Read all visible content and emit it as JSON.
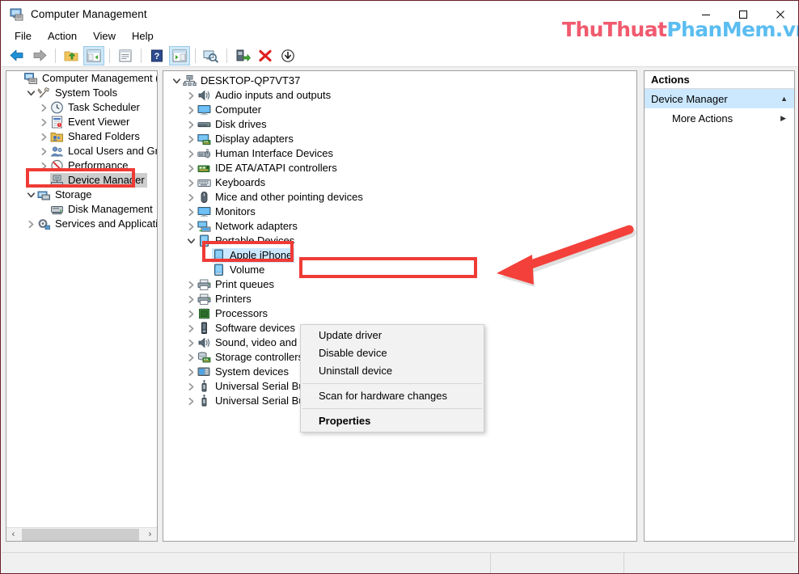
{
  "window": {
    "title": "Computer Management",
    "icon": "computer-management-icon",
    "minimize_label": "─",
    "maximize_label": "□",
    "close_label": "✕"
  },
  "watermark": {
    "part1": "ThuThuat",
    "part2": "PhanMem.vn",
    "color1": "#f05a6e",
    "color2": "#5bbdf0"
  },
  "menubar": {
    "items": [
      "File",
      "Action",
      "View",
      "Help"
    ]
  },
  "toolbar": {
    "buttons": [
      {
        "name": "back-icon",
        "tip": "Back"
      },
      {
        "name": "forward-icon",
        "tip": "Forward"
      },
      {
        "name": "up-folder-icon",
        "tip": "Up one level"
      },
      {
        "name": "show-hide-console-tree-icon",
        "tip": "Show/Hide Console Tree"
      },
      {
        "name": "properties-icon",
        "tip": "Properties"
      },
      {
        "name": "help-icon",
        "tip": "Help"
      },
      {
        "name": "show-hide-action-pane-icon",
        "tip": "Show/Hide Action Pane"
      },
      {
        "name": "scan-hardware-icon",
        "tip": "Scan for hardware changes"
      },
      {
        "name": "update-driver-icon",
        "tip": "Update driver"
      },
      {
        "name": "uninstall-device-icon",
        "tip": "Uninstall device"
      },
      {
        "name": "disable-device-icon",
        "tip": "Disable device"
      }
    ]
  },
  "console_tree": {
    "items": [
      {
        "label": "Computer Management (Local",
        "depth": 0,
        "chevron": "",
        "icon": "computer-management-icon",
        "selected": "none"
      },
      {
        "label": "System Tools",
        "depth": 1,
        "chevron": "expanded",
        "icon": "system-tools-icon",
        "selected": "none"
      },
      {
        "label": "Task Scheduler",
        "depth": 2,
        "chevron": "collapsed",
        "icon": "task-scheduler-icon",
        "selected": "none"
      },
      {
        "label": "Event Viewer",
        "depth": 2,
        "chevron": "collapsed",
        "icon": "event-viewer-icon",
        "selected": "none"
      },
      {
        "label": "Shared Folders",
        "depth": 2,
        "chevron": "collapsed",
        "icon": "shared-folders-icon",
        "selected": "none"
      },
      {
        "label": "Local Users and Groups",
        "depth": 2,
        "chevron": "collapsed",
        "icon": "local-users-icon",
        "selected": "none"
      },
      {
        "label": "Performance",
        "depth": 2,
        "chevron": "collapsed",
        "icon": "performance-icon",
        "selected": "none"
      },
      {
        "label": "Device Manager",
        "depth": 2,
        "chevron": "",
        "icon": "device-manager-icon",
        "selected": "gray"
      },
      {
        "label": "Storage",
        "depth": 1,
        "chevron": "expanded",
        "icon": "storage-icon",
        "selected": "none"
      },
      {
        "label": "Disk Management",
        "depth": 2,
        "chevron": "",
        "icon": "disk-management-icon",
        "selected": "none"
      },
      {
        "label": "Services and Applications",
        "depth": 1,
        "chevron": "collapsed",
        "icon": "services-icon",
        "selected": "none"
      }
    ]
  },
  "device_tree": {
    "items": [
      {
        "label": "DESKTOP-QP7VT37",
        "depth": 0,
        "chevron": "expanded",
        "icon": "computer-node-icon",
        "selected": "none"
      },
      {
        "label": "Audio inputs and outputs",
        "depth": 1,
        "chevron": "collapsed",
        "icon": "speaker-icon",
        "selected": "none"
      },
      {
        "label": "Computer",
        "depth": 1,
        "chevron": "collapsed",
        "icon": "monitor-icon",
        "selected": "none"
      },
      {
        "label": "Disk drives",
        "depth": 1,
        "chevron": "collapsed",
        "icon": "disk-drive-icon",
        "selected": "none"
      },
      {
        "label": "Display adapters",
        "depth": 1,
        "chevron": "collapsed",
        "icon": "display-adapter-icon",
        "selected": "none"
      },
      {
        "label": "Human Interface Devices",
        "depth": 1,
        "chevron": "collapsed",
        "icon": "hid-icon",
        "selected": "none"
      },
      {
        "label": "IDE ATA/ATAPI controllers",
        "depth": 1,
        "chevron": "collapsed",
        "icon": "ide-controller-icon",
        "selected": "none"
      },
      {
        "label": "Keyboards",
        "depth": 1,
        "chevron": "collapsed",
        "icon": "keyboard-icon",
        "selected": "none"
      },
      {
        "label": "Mice and other pointing devices",
        "depth": 1,
        "chevron": "collapsed",
        "icon": "mouse-icon",
        "selected": "none"
      },
      {
        "label": "Monitors",
        "depth": 1,
        "chevron": "collapsed",
        "icon": "monitor-icon",
        "selected": "none"
      },
      {
        "label": "Network adapters",
        "depth": 1,
        "chevron": "collapsed",
        "icon": "network-adapter-icon",
        "selected": "none"
      },
      {
        "label": "Portable Devices",
        "depth": 1,
        "chevron": "expanded",
        "icon": "portable-device-icon",
        "selected": "none"
      },
      {
        "label": "Apple iPhone",
        "depth": 2,
        "chevron": "",
        "icon": "portable-device-icon",
        "selected": "blue"
      },
      {
        "label": "Volume",
        "depth": 2,
        "chevron": "",
        "icon": "portable-device-icon",
        "selected": "none"
      },
      {
        "label": "Print queues",
        "depth": 1,
        "chevron": "collapsed",
        "icon": "printer-queue-icon",
        "selected": "none"
      },
      {
        "label": "Printers",
        "depth": 1,
        "chevron": "collapsed",
        "icon": "printer-icon",
        "selected": "none"
      },
      {
        "label": "Processors",
        "depth": 1,
        "chevron": "collapsed",
        "icon": "processor-icon",
        "selected": "none"
      },
      {
        "label": "Software devices",
        "depth": 1,
        "chevron": "collapsed",
        "icon": "software-device-icon",
        "selected": "none"
      },
      {
        "label": "Sound, video and game controllers",
        "depth": 1,
        "chevron": "collapsed",
        "icon": "speaker-icon",
        "selected": "none"
      },
      {
        "label": "Storage controllers",
        "depth": 1,
        "chevron": "collapsed",
        "icon": "storage-controller-icon",
        "selected": "none"
      },
      {
        "label": "System devices",
        "depth": 1,
        "chevron": "collapsed",
        "icon": "system-device-icon",
        "selected": "none"
      },
      {
        "label": "Universal Serial Bus controllers",
        "depth": 1,
        "chevron": "collapsed",
        "icon": "usb-icon",
        "selected": "none"
      },
      {
        "label": "Universal Serial Bus devices",
        "depth": 1,
        "chevron": "collapsed",
        "icon": "usb-icon",
        "selected": "none"
      }
    ]
  },
  "context_menu": {
    "items": [
      {
        "label": "Update driver",
        "bold": false,
        "highlighted": true
      },
      {
        "label": "Disable device",
        "bold": false,
        "highlighted": false
      },
      {
        "label": "Uninstall device",
        "bold": false,
        "highlighted": false
      },
      {
        "separator": true
      },
      {
        "label": "Scan for hardware changes",
        "bold": false,
        "highlighted": false
      },
      {
        "separator": true
      },
      {
        "label": "Properties",
        "bold": true,
        "highlighted": false
      }
    ]
  },
  "actions_pane": {
    "header": "Actions",
    "group_label": "Device Manager",
    "group_chevron": "▲",
    "more_actions_label": "More Actions",
    "more_actions_chevron": "▶"
  },
  "scrollbar": {
    "left_arrow": "‹",
    "right_arrow": "›"
  },
  "annotations": {
    "color": "#ef3b36",
    "boxes": [
      "device-manager-tree-item",
      "apple-iphone-device",
      "update-driver-menu-item"
    ],
    "arrow": "points-left-to-update-driver"
  },
  "statusbar": {
    "cells": [
      "",
      "",
      ""
    ]
  }
}
